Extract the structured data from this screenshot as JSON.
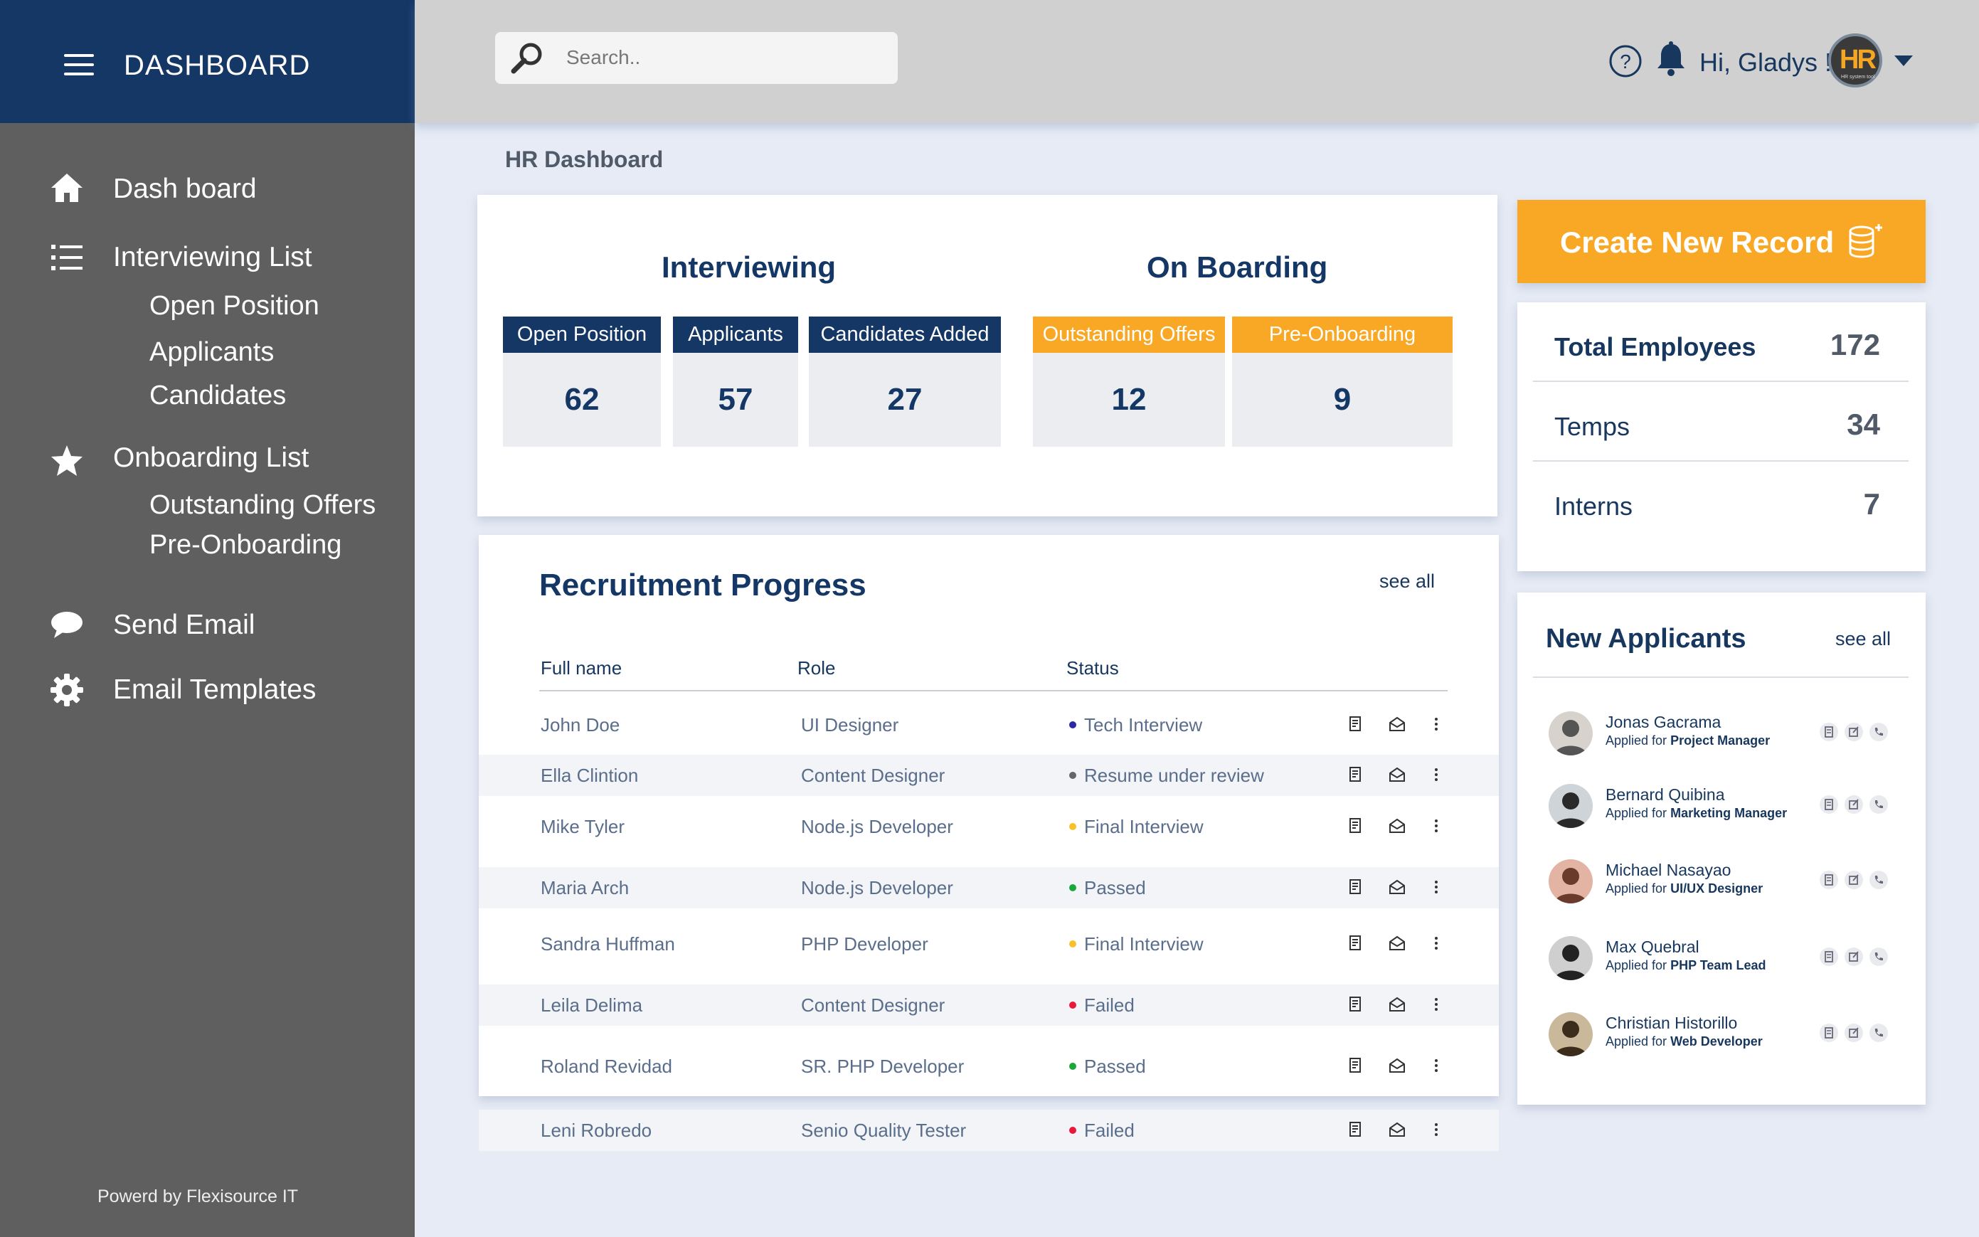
{
  "sidebar": {
    "title": "DASHBOARD",
    "nav": [
      {
        "label": "Dash board",
        "icon": "home-icon"
      },
      {
        "label": "Interviewing List",
        "icon": "list-icon"
      },
      {
        "label": "Onboarding List",
        "icon": "star-icon"
      },
      {
        "label": "Send Email",
        "icon": "chat-bubble-icon"
      },
      {
        "label": "Email Templates",
        "icon": "gear-icon"
      }
    ],
    "interviewing_sub": [
      "Open Position",
      "Applicants",
      "Candidates"
    ],
    "onboarding_sub": [
      "Outstanding Offers",
      "Pre-Onboarding"
    ],
    "footer": "Powerd by Flexisource IT"
  },
  "topbar": {
    "search_placeholder": "Search..",
    "greeting": "Hi, Gladys !",
    "avatar_text": "HR",
    "avatar_caption": "HR system tool"
  },
  "page_title": "HR Dashboard",
  "interviewing": {
    "title": "Interviewing",
    "stats": [
      {
        "label": "Open Position",
        "value": "62"
      },
      {
        "label": "Applicants",
        "value": "57"
      },
      {
        "label": "Candidates Added",
        "value": "27"
      }
    ]
  },
  "onboarding": {
    "title": "On Boarding",
    "stats": [
      {
        "label": "Outstanding Offers",
        "value": "12"
      },
      {
        "label": "Pre-Onboarding",
        "value": "9"
      }
    ]
  },
  "create_button": "Create New Record",
  "totals": [
    {
      "label": "Total Employees",
      "value": "172"
    },
    {
      "label": "Temps",
      "value": "34"
    },
    {
      "label": "Interns",
      "value": "7"
    }
  ],
  "recruitment": {
    "title": "Recruitment Progress",
    "see_all": "see all",
    "columns": [
      "Full name",
      "Role",
      "Status"
    ],
    "rows": [
      {
        "name": "John Doe",
        "role": "UI Designer",
        "status": "Tech Interview",
        "status_color": "#2a2aa8"
      },
      {
        "name": "Ella Clintion",
        "role": "Content Designer",
        "status": "Resume under review",
        "status_color": "#666666"
      },
      {
        "name": "Mike Tyler",
        "role": "Node.js Developer",
        "status": "Final Interview",
        "status_color": "#f9c02a"
      },
      {
        "name": "Maria Arch",
        "role": "Node.js Developer",
        "status": "Passed",
        "status_color": "#1aa83a"
      },
      {
        "name": "Sandra Huffman",
        "role": "PHP Developer",
        "status": "Final Interview",
        "status_color": "#f9c02a"
      },
      {
        "name": "Leila Delima",
        "role": "Content Designer",
        "status": "Failed",
        "status_color": "#e8183c"
      },
      {
        "name": "Roland Revidad",
        "role": "SR. PHP Developer",
        "status": "Passed",
        "status_color": "#1aa83a"
      },
      {
        "name": "Leni Robredo",
        "role": "Senio Quality Tester",
        "status": "Failed",
        "status_color": "#e8183c"
      }
    ]
  },
  "new_applicants": {
    "title": "New Applicants",
    "see_all": "see all",
    "applied_prefix": "Applied for",
    "items": [
      {
        "name": "Jonas Gacrama",
        "role": "Project Manager"
      },
      {
        "name": "Bernard Quibina",
        "role": "Marketing Manager"
      },
      {
        "name": "Michael Nasayao",
        "role": "UI/UX Designer"
      },
      {
        "name": "Max Quebral",
        "role": "PHP Team Lead"
      },
      {
        "name": "Christian Historillo",
        "role": "Web Developer"
      }
    ]
  },
  "colors": {
    "navy": "#143766",
    "orange": "#f9a825",
    "sidebar": "#5f5f5f",
    "background": "#e6ebf5"
  }
}
